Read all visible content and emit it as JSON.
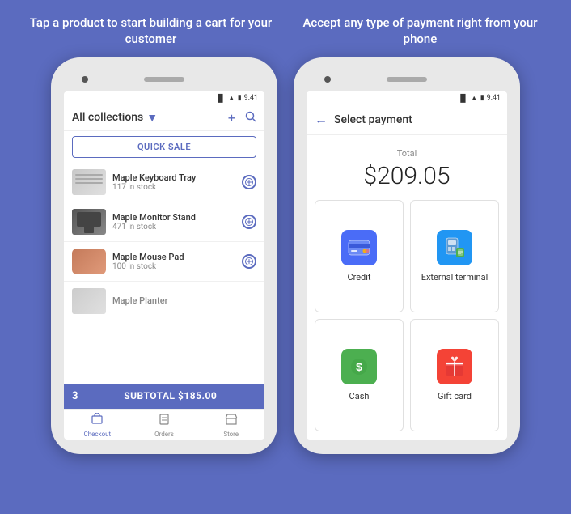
{
  "page": {
    "background": "#5B6BBF"
  },
  "left_panel": {
    "headline": "Tap a product to start building a\ncart for your customer"
  },
  "right_panel": {
    "headline": "Accept any type of payment\nright from your phone"
  },
  "phone1": {
    "status_time": "9:41",
    "header": {
      "collections_label": "All collections",
      "plus_icon": "+",
      "search_icon": "🔍"
    },
    "quick_sale_button": "QUICK SALE",
    "products": [
      {
        "name": "Maple Keyboard Tray",
        "stock": "117 in stock",
        "thumb_type": "keyboard"
      },
      {
        "name": "Maple Monitor Stand",
        "stock": "471 in stock",
        "thumb_type": "monitor"
      },
      {
        "name": "Maple Mouse Pad",
        "stock": "100 in stock",
        "thumb_type": "mouse"
      },
      {
        "name": "Maple Planter",
        "stock": "",
        "thumb_type": "planter"
      }
    ],
    "cart_bar": {
      "count": "3",
      "subtotal": "SUBTOTAL $185.00"
    },
    "nav": [
      {
        "label": "Checkout",
        "icon": "🛒",
        "active": true
      },
      {
        "label": "Orders",
        "icon": "📥",
        "active": false
      },
      {
        "label": "Store",
        "icon": "🏪",
        "active": false
      }
    ]
  },
  "phone2": {
    "status_time": "9:41",
    "header": {
      "back_icon": "←",
      "title": "Select payment"
    },
    "total": {
      "label": "Total",
      "amount": "$209.05"
    },
    "payment_options": [
      {
        "key": "credit",
        "label": "Credit",
        "bg": "#4A6CF7"
      },
      {
        "key": "terminal",
        "label": "External terminal",
        "bg": "#2196F3"
      },
      {
        "key": "cash",
        "label": "Cash",
        "bg": "#4CAF50"
      },
      {
        "key": "gift",
        "label": "Gift card",
        "bg": "#F44336"
      }
    ]
  }
}
